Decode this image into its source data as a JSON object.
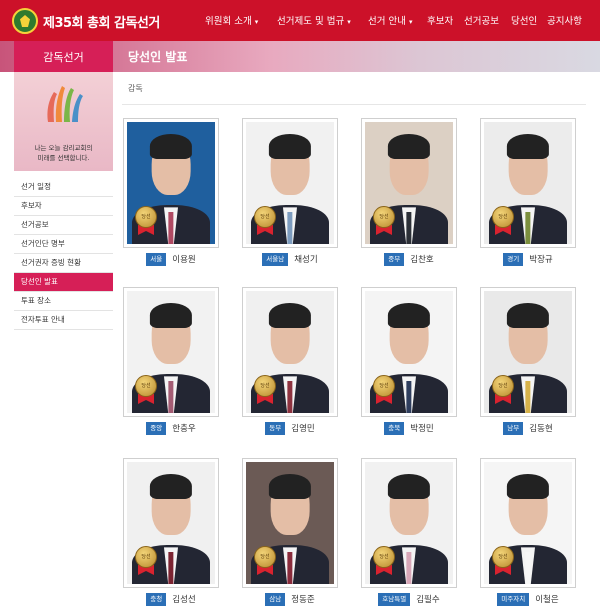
{
  "header": {
    "logo_text": "제35회 총회 감독선거",
    "nav": [
      {
        "label": "위원회 소개",
        "caret": "▾"
      },
      {
        "label": "선거제도 및 법규",
        "caret": "▾"
      },
      {
        "label": "선거 안내",
        "caret": "▾"
      },
      {
        "label": "후보자",
        "caret": ""
      },
      {
        "label": "선거공보",
        "caret": ""
      },
      {
        "label": "당선인",
        "caret": ""
      },
      {
        "label": "공지사항",
        "caret": ""
      }
    ]
  },
  "sidebar": {
    "section_title": "감독선거",
    "banner_line1": "나는 오늘 감리교회의",
    "banner_line2": "미래를 선택합니다.",
    "items": [
      {
        "label": "선거 일정"
      },
      {
        "label": "후보자"
      },
      {
        "label": "선거공보"
      },
      {
        "label": "선거인단 명부"
      },
      {
        "label": "선거권자 증빙 현황"
      },
      {
        "label": "당선인 발표"
      },
      {
        "label": "투표 장소"
      },
      {
        "label": "전자투표 안내"
      }
    ],
    "active_index": 5
  },
  "main": {
    "page_title": "당선인 발표",
    "breadcrumb": "감독",
    "medal_text": "당선",
    "winners": [
      {
        "region": "서울",
        "name": "이용원",
        "bg": "#1f5f9e",
        "tie": "#b04a63"
      },
      {
        "region": "서울남",
        "name": "채성기",
        "bg": "#f1f1f1",
        "tie": "#7d9cbf"
      },
      {
        "region": "중부",
        "name": "김찬호",
        "bg": "#dcd0c4",
        "tie": "#2c3038"
      },
      {
        "region": "경기",
        "name": "박장규",
        "bg": "#ececec",
        "tie": "#7c8f3e"
      },
      {
        "region": "중앙",
        "name": "한충우",
        "bg": "#f2f2f2",
        "tie": "#a45c74"
      },
      {
        "region": "동부",
        "name": "김영민",
        "bg": "#f0f0f0",
        "tie": "#8e3340"
      },
      {
        "region": "충북",
        "name": "박정민",
        "bg": "#f4f4f4",
        "tie": "#2f3e5e"
      },
      {
        "region": "남부",
        "name": "김동현",
        "bg": "#e9e9e9",
        "tie": "#d7b24a"
      },
      {
        "region": "충청",
        "name": "김성선",
        "bg": "#f0f0f0",
        "tie": "#7c2432"
      },
      {
        "region": "삼남",
        "name": "정동준",
        "bg": "#6b5a55",
        "tie": "#8a2c3c"
      },
      {
        "region": "호남특별",
        "name": "김필수",
        "bg": "#f1f1f1",
        "tie": "#d8a7b8"
      },
      {
        "region": "미주자치",
        "name": "이철은",
        "bg": "#f5f5f5",
        "tie": "#f7f7f7"
      }
    ]
  }
}
